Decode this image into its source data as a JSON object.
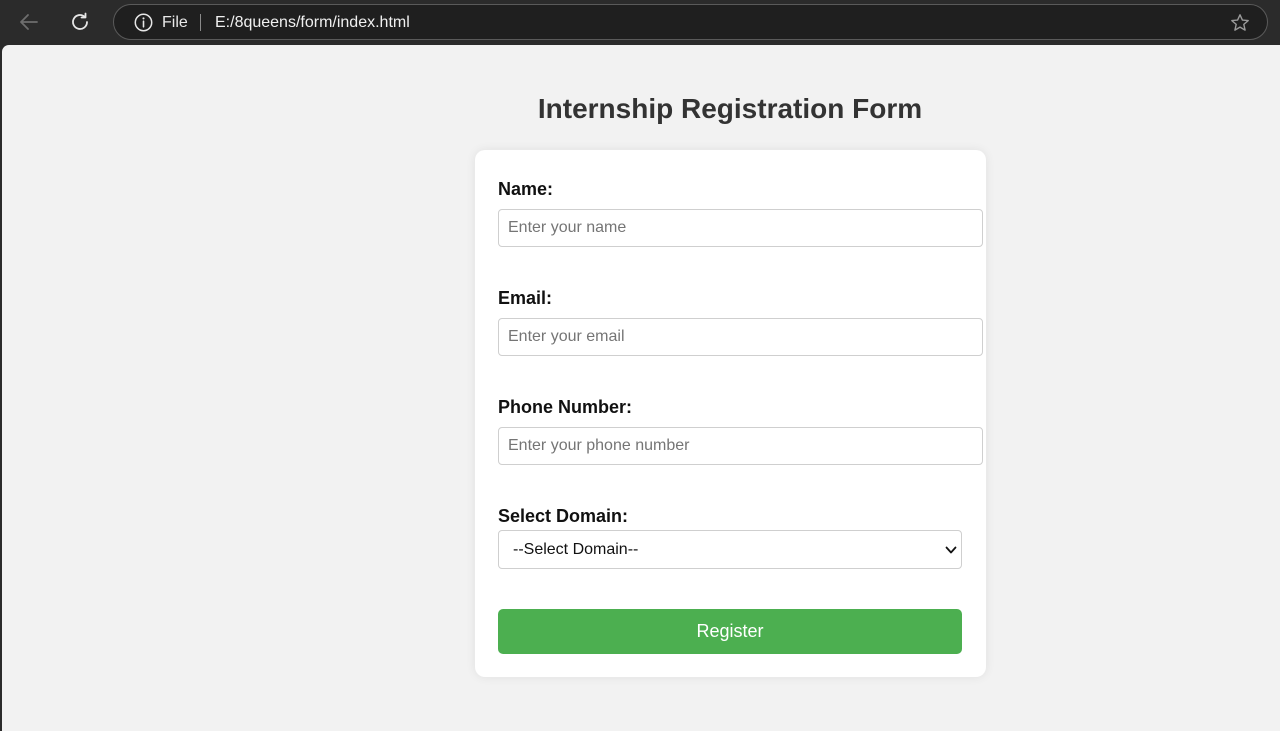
{
  "browser": {
    "scheme_label": "File",
    "url": "E:/8queens/form/index.html",
    "icons": {
      "back": "arrow-left-icon",
      "reload": "reload-icon",
      "info": "info-icon",
      "bookmark": "star-icon"
    }
  },
  "page": {
    "title": "Internship Registration Form"
  },
  "form": {
    "name": {
      "label": "Name:",
      "placeholder": "Enter your name",
      "value": ""
    },
    "email": {
      "label": "Email:",
      "placeholder": "Enter your email",
      "value": ""
    },
    "phone": {
      "label": "Phone Number:",
      "placeholder": "Enter your phone number",
      "value": ""
    },
    "domain": {
      "label": "Select Domain:",
      "selected": "--Select Domain--"
    },
    "submit_label": "Register"
  },
  "colors": {
    "chrome_bg": "#2b2b2b",
    "page_bg": "#f2f2f2",
    "card_bg": "#ffffff",
    "button_bg": "#4caf50",
    "title_text": "#333333"
  }
}
